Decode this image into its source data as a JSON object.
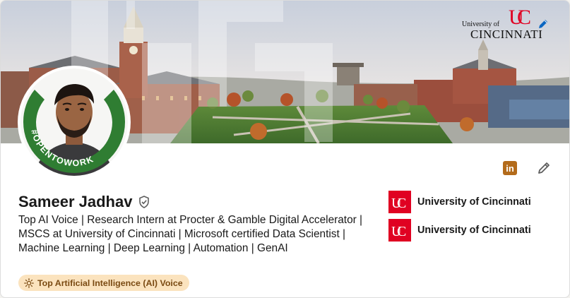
{
  "banner": {
    "institution_small": "University of",
    "institution_large": "CINCINNATI"
  },
  "avatar": {
    "badge_text": "#OPENTOWORK"
  },
  "profile": {
    "name": "Sameer Jadhav",
    "headline": "Top AI Voice | Research Intern at Procter & Gamble Digital Accelerator | MSCS at University of Cincinnati | Microsoft certified Data Scientist | Machine Learning | Deep Learning | Automation | GenAI",
    "badge_label": "Top Artificial Intelligence (AI) Voice"
  },
  "actions": {
    "linkedin_icon_text": "in"
  },
  "education": [
    {
      "label": "University of Cincinnati"
    },
    {
      "label": "University of Cincinnati"
    }
  ],
  "colors": {
    "uc_red": "#e00122",
    "open_to_work_green": "#2f7d32",
    "avatar_ring_blue": "#0a66c2",
    "badge_bg": "#fbe3be",
    "badge_text": "#7a4a12"
  },
  "icons": [
    "pencil-icon",
    "linkedin-icon",
    "verified-shield-icon",
    "sun-icon",
    "uc-logo-icon"
  ]
}
